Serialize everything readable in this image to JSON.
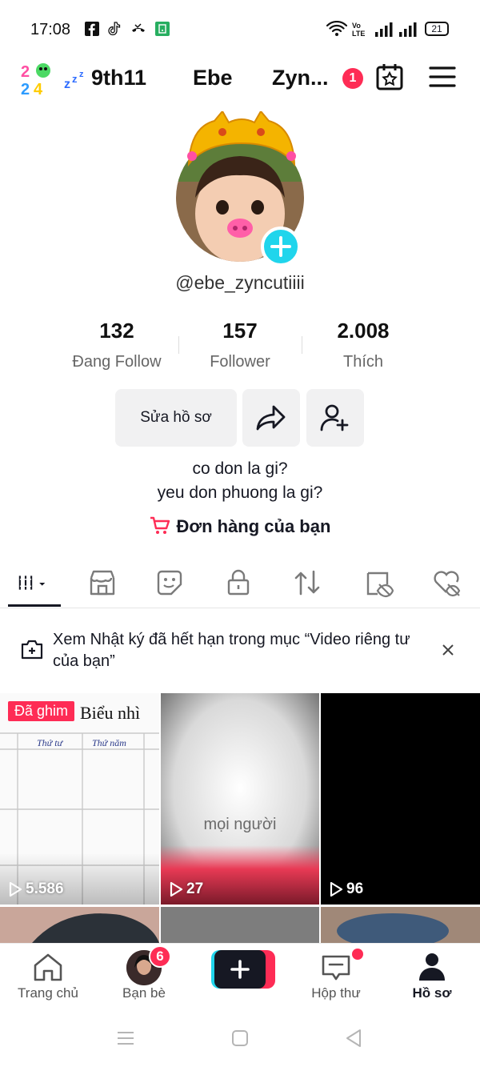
{
  "status_bar": {
    "time": "17:08",
    "battery": "21",
    "network": "VoLTE"
  },
  "header": {
    "logo": "2024",
    "accounts": [
      "9th11",
      "Ebe",
      "Zyn..."
    ],
    "notification_count": "1"
  },
  "profile": {
    "username": "@ebe_zyncutiiii",
    "stats": [
      {
        "value": "132",
        "label": "Đang Follow"
      },
      {
        "value": "157",
        "label": "Follower"
      },
      {
        "value": "2.008",
        "label": "Thích"
      }
    ],
    "edit_button": "Sửa hồ sơ",
    "bio_lines": [
      "co don la gi?",
      "yeu don phuong la gi?"
    ],
    "orders_link": "Đơn hàng của bạn"
  },
  "notice": {
    "text": "Xem Nhật ký đã hết hạn trong mục “Video riêng tư của bạn”"
  },
  "videos": [
    {
      "views": "5.586",
      "pinned_label": "Đã ghim",
      "text_top": "Biểu nhì",
      "col_labels": [
        "Thứ tư",
        "Thứ năm"
      ]
    },
    {
      "views": "27",
      "text_mid": "mọi người"
    },
    {
      "views": "96"
    }
  ],
  "bottom_nav": {
    "items": [
      "Trang chủ",
      "Bạn bè",
      "",
      "Hộp thư",
      "Hồ sơ"
    ],
    "friends_badge": "6"
  },
  "colors": {
    "accent_red": "#fe2c55",
    "accent_cyan": "#20d5ec"
  }
}
